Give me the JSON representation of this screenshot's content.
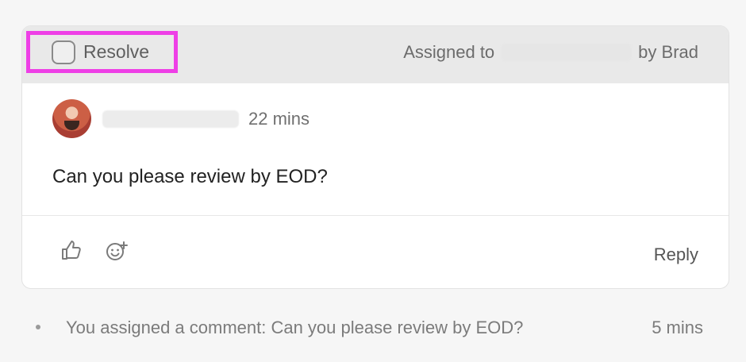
{
  "card": {
    "resolve_label": "Resolve",
    "assigned_prefix": "Assigned to",
    "assigned_suffix": "by Brad",
    "time": "22 mins",
    "comment": "Can you please review by EOD?",
    "reply_label": "Reply",
    "icons": {
      "like": "thumbs-up-icon",
      "emoji": "emoji-add-icon"
    }
  },
  "activity": {
    "text": "You assigned a comment: Can you please review by EOD?",
    "time": "5 mins"
  },
  "colors": {
    "highlight": "#ee3fe6",
    "header_bg": "#e9e9e9",
    "page_bg": "#f6f6f6"
  }
}
